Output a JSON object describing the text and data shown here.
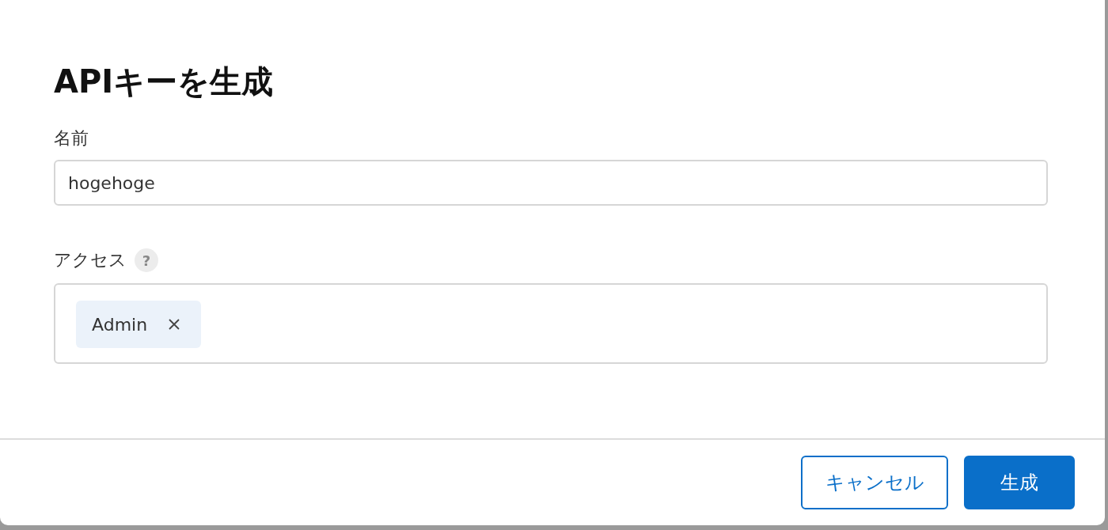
{
  "dialog": {
    "title": "APIキーを生成",
    "name_field": {
      "label": "名前",
      "value": "hogehoge"
    },
    "access_field": {
      "label": "アクセス",
      "help": "?",
      "tags": [
        {
          "label": "Admin"
        }
      ]
    },
    "buttons": [
      {
        "label": "キャンセル",
        "kind": "secondary"
      },
      {
        "label": "生成",
        "kind": "primary"
      }
    ]
  }
}
